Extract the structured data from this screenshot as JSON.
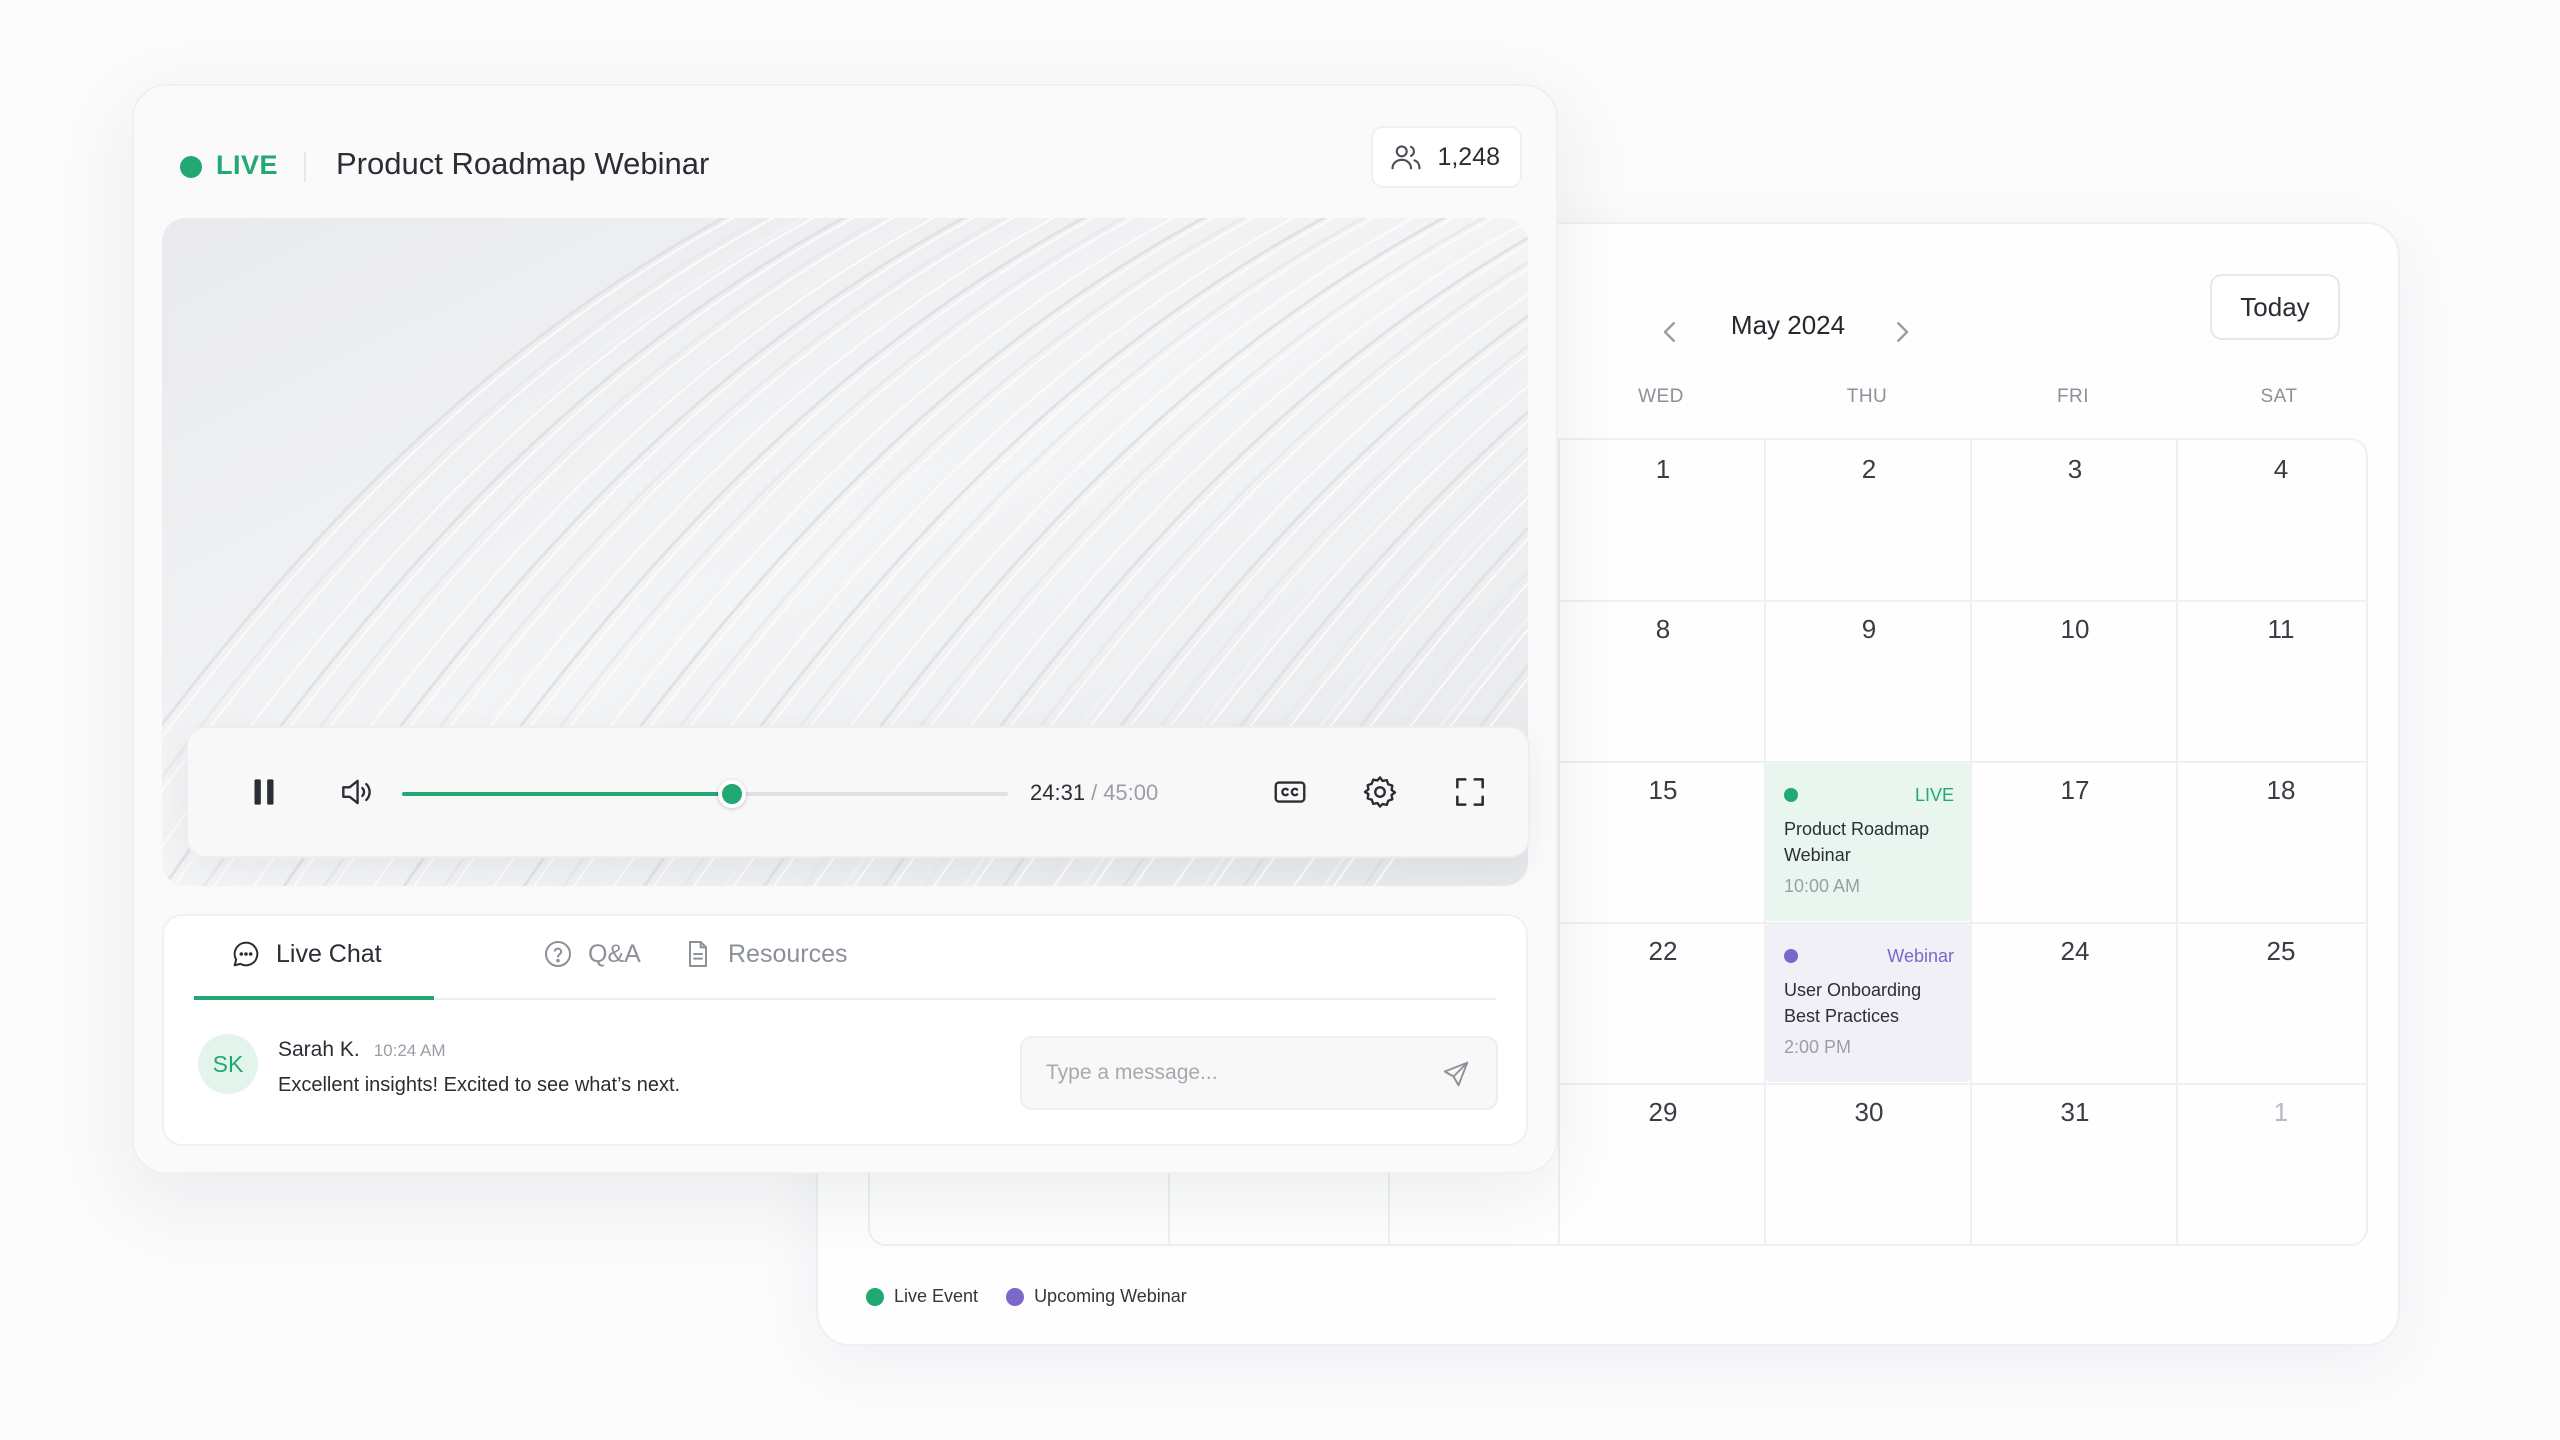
{
  "colors": {
    "accent": "#21a873",
    "webinar": "#7b68c8",
    "muted": "#9a9ea6"
  },
  "webinar": {
    "live_label": "LIVE",
    "title": "Product Roadmap Webinar",
    "viewers": "1,248",
    "player": {
      "current_time": "24:31",
      "separator": "/",
      "total_time": "45:00",
      "progress": 0.545,
      "icons": [
        "pause-icon",
        "volume-icon",
        "captions-icon",
        "settings-gear-icon",
        "fullscreen-icon"
      ]
    },
    "tabs": [
      {
        "label": "Live Chat",
        "icon": "chat-bubble-icon",
        "active": true
      },
      {
        "label": "Q&A",
        "icon": "question-circle-icon",
        "active": false
      },
      {
        "label": "Resources",
        "icon": "document-icon",
        "active": false
      }
    ],
    "message": {
      "avatar_initials": "SK",
      "author": "Sarah K.",
      "time": "10:24 AM",
      "text": "Excellent insights! Excited to see what’s next."
    },
    "input": {
      "placeholder": "Type a message..."
    }
  },
  "calendar": {
    "month_label": "May 2024",
    "today_button": "Today",
    "weekdays": [
      "WED",
      "THU",
      "FRI",
      "SAT"
    ],
    "weeks": [
      [
        "1",
        "2",
        "3",
        "4"
      ],
      [
        "8",
        "9",
        "10",
        "11"
      ],
      [
        "15",
        "",
        "17",
        "18"
      ],
      [
        "22",
        "",
        "24",
        "25"
      ],
      [
        "29",
        "30",
        "31",
        "1"
      ]
    ],
    "events": {
      "live": {
        "tag": "LIVE",
        "title": "Product Roadmap Webinar",
        "time": "10:00 AM"
      },
      "webinar": {
        "tag": "Webinar",
        "title": "User Onboarding Best Practices",
        "time": "2:00 PM"
      }
    },
    "legend": [
      {
        "label": "Live Event",
        "color": "#21a873"
      },
      {
        "label": "Upcoming Webinar",
        "color": "#7b68c8"
      }
    ]
  }
}
